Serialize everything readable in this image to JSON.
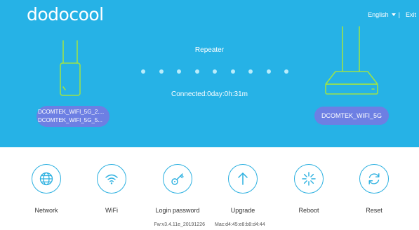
{
  "brand": {
    "logo_text": "dodocool"
  },
  "header": {
    "language": "English",
    "separator": "|",
    "exit": "Exit"
  },
  "status": {
    "mode": "Repeater",
    "connected": "Connected:0day:0h:31m",
    "dot_count": 9
  },
  "extender": {
    "icon": "extender-device-icon",
    "ssids": [
      "DCOMTEK_WIFI_5G_2....",
      "DCOMTEK_WIFI_5G_5..."
    ]
  },
  "router": {
    "icon": "router-device-icon",
    "ssid": "DCOMTEK_WIFI_5G"
  },
  "actions": [
    {
      "label": "Network",
      "icon": "globe-icon"
    },
    {
      "label": "WiFi",
      "icon": "wifi-icon"
    },
    {
      "label": "Login password",
      "icon": "key-icon"
    },
    {
      "label": "Upgrade",
      "icon": "arrow-up-icon"
    },
    {
      "label": "Reboot",
      "icon": "reboot-icon"
    },
    {
      "label": "Reset",
      "icon": "reset-icon"
    }
  ],
  "footer": {
    "firmware": "Fw:v3.4.11e_20191226",
    "mac": "Mac:d4:45:e8:b8:d4:44"
  },
  "colors": {
    "header_bg": "#26b2e6",
    "device_outline": "#9be24a",
    "ssid_pill": "#6d7fe3",
    "icon_accent": "#2bb0e0"
  }
}
